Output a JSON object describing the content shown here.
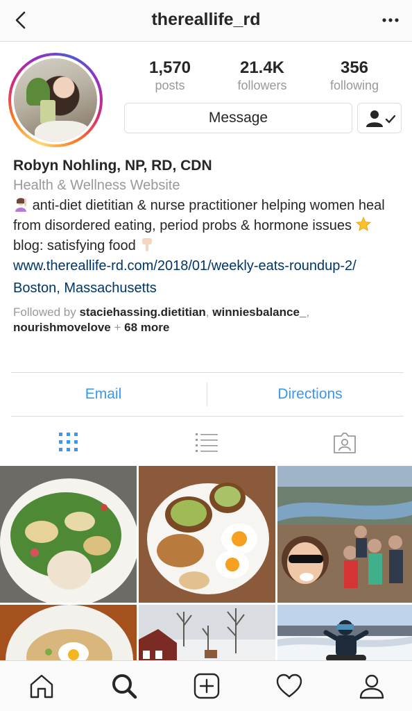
{
  "header": {
    "username": "thereallife_rd",
    "back_icon": "chevron-left-icon",
    "more_icon": "ellipsis-icon"
  },
  "profile": {
    "stats": [
      {
        "value": "1,570",
        "label": "posts"
      },
      {
        "value": "21.4K",
        "label": "followers"
      },
      {
        "value": "356",
        "label": "following"
      }
    ],
    "message_label": "Message",
    "name": "Robyn Nohling, NP, RD, CDN",
    "category": "Health & Wellness Website",
    "bio_line1": "anti-diet dietitian & nurse practitioner helping women heal from disordered eating, period probs & hormone issues",
    "bio_line2": "blog: satisfying food",
    "link": "www.thereallife-rd.com/2018/01/weekly-eats-roundup-2/",
    "location": "Boston, Massachusetts",
    "followed_prefix": "Followed by",
    "followed_user1": "staciehassing.dietitian",
    "followed_sep": ",",
    "followed_user2": "winniesbalance_",
    "followed_user3": "nourishmovelove",
    "followed_plus": "+",
    "followed_more": "68 more"
  },
  "actions": {
    "email": "Email",
    "directions": "Directions"
  },
  "tabs": [
    "grid-icon",
    "list-icon",
    "tagged-icon"
  ],
  "bottom_nav": [
    "home-icon",
    "search-icon",
    "add-icon",
    "heart-icon",
    "profile-icon"
  ],
  "colors": {
    "link_blue": "#3897f0",
    "dark_link": "#003569",
    "border": "#dbdbdb"
  }
}
